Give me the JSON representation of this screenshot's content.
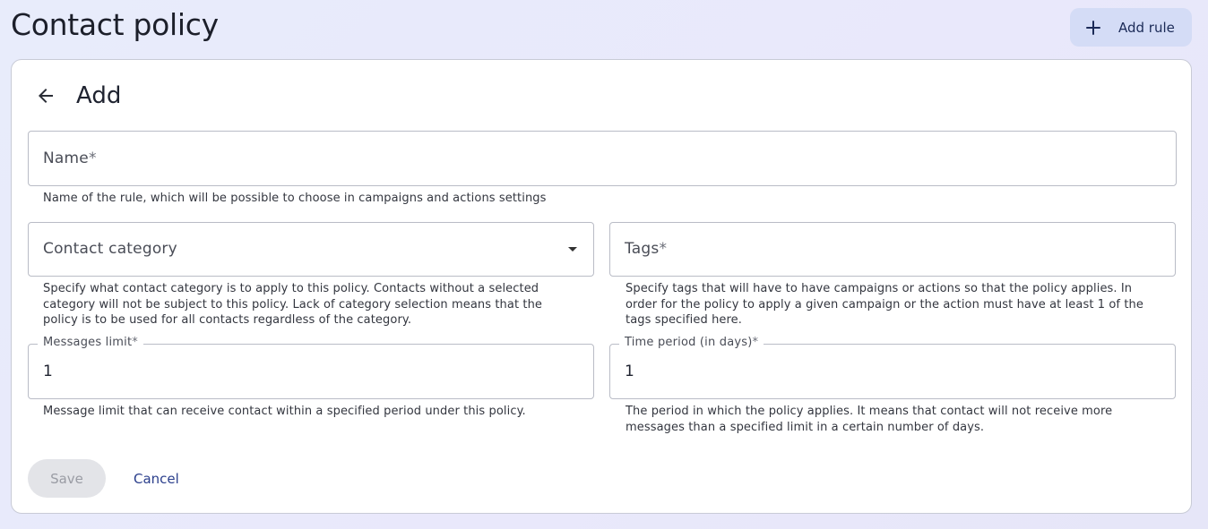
{
  "header": {
    "title": "Contact policy",
    "add_rule_label": "Add rule"
  },
  "form": {
    "title": "Add",
    "name": {
      "placeholder": "Name",
      "required_mark": "*",
      "helper": "Name of the rule, which will be possible to choose in campaigns and actions settings"
    },
    "contact_category": {
      "placeholder": "Contact category",
      "helper_lines": [
        "Specify what contact category is to apply to this policy. Contacts without a selected",
        "category will not be subject to this policy. Lack of category selection means that the",
        "policy is to be used for all contacts regardless of the category."
      ]
    },
    "tags": {
      "placeholder": "Tags",
      "required_mark": "*",
      "helper_lines": [
        "Specify tags that will have to have campaigns or actions so that the policy applies. In",
        "order for the policy to apply a given campaign or the action must have at least 1 of the",
        "tags specified here."
      ]
    },
    "messages_limit": {
      "label": "Messages limit",
      "required_mark": "*",
      "value": "1",
      "helper": "Message limit that can receive contact within a specified period under this policy."
    },
    "time_period": {
      "label": "Time period (in days)",
      "required_mark": "*",
      "value": "1",
      "helper_lines": [
        "The period in which the policy applies. It means that contact will not receive more",
        "messages than a specified limit in a certain number of days."
      ]
    },
    "save_label": "Save",
    "cancel_label": "Cancel"
  },
  "colors": {
    "accent": "#2b3f8c",
    "add_rule_bg": "#d4dcf6",
    "border": "#b9bcc6"
  },
  "icons": {
    "add": "plus-icon",
    "back": "arrow-left-icon",
    "dropdown": "caret-down-icon"
  }
}
